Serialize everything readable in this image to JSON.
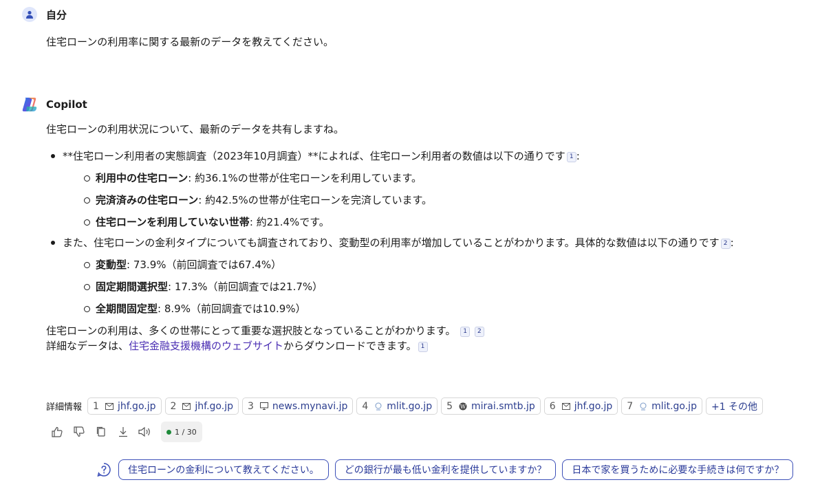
{
  "user": {
    "name": "自分",
    "message": "住宅ローンの利用率に関する最新のデータを教えてください。"
  },
  "copilot": {
    "name": "Copilot",
    "intro": "住宅ローンの利用状況について、最新のデータを共有しますね。",
    "bullet1": {
      "text": "**住宅ローン利用者の実態調査（2023年10月調査）**によれば、住宅ローン利用者の数値は以下の通りです",
      "cite": "1",
      "suffix": ":",
      "items": [
        {
          "label": "利用中の住宅ローン",
          "text": ": 約36.1%の世帯が住宅ローンを利用しています。"
        },
        {
          "label": "完済済みの住宅ローン",
          "text": ": 約42.5%の世帯が住宅ローンを完済しています。"
        },
        {
          "label": "住宅ローンを利用していない世帯",
          "text": ": 約21.4%です。"
        }
      ]
    },
    "bullet2": {
      "text": "また、住宅ローンの金利タイプについても調査されており、変動型の利用率が増加していることがわかります。具体的な数値は以下の通りです",
      "cite": "2",
      "suffix": ":",
      "items": [
        {
          "label": "変動型",
          "text": ": 73.9%（前回調査では67.4%）"
        },
        {
          "label": "固定期間選択型",
          "text": ": 17.3%（前回調査では21.7%）"
        },
        {
          "label": "全期間固定型",
          "text": ": 8.9%（前回調査では10.9%）"
        }
      ]
    },
    "summary": "住宅ローンの利用は、多くの世帯にとって重要な選択肢となっていることがわかります。",
    "summary_cites": [
      "1",
      "2"
    ],
    "download_prefix": "詳細なデータは、",
    "download_link": "住宅金融支援機構のウェブサイト",
    "download_suffix": "からダウンロードできます。",
    "download_cite": "1"
  },
  "references": {
    "label": "詳細情報",
    "items": [
      {
        "num": "1",
        "icon": "mail-icon",
        "domain": "jhf.go.jp"
      },
      {
        "num": "2",
        "icon": "mail-icon",
        "domain": "jhf.go.jp"
      },
      {
        "num": "3",
        "icon": "monitor-icon",
        "domain": "news.mynavi.jp"
      },
      {
        "num": "4",
        "icon": "globe-icon",
        "domain": "mlit.go.jp"
      },
      {
        "num": "5",
        "icon": "wordpress-icon",
        "domain": "mirai.smtb.jp"
      },
      {
        "num": "6",
        "icon": "mail-icon",
        "domain": "jhf.go.jp"
      },
      {
        "num": "7",
        "icon": "globe-icon",
        "domain": "mlit.go.jp"
      }
    ],
    "more": "+1 その他"
  },
  "actions": {
    "counter": "1 / 30",
    "counter_color": "#1e8a3a"
  },
  "suggestions": [
    "住宅ローンの金利について教えてください。",
    "どの銀行が最も低い金利を提供していますか？",
    "日本で家を買うために必要な手続きは何ですか？"
  ],
  "colors": {
    "accent": "#3b4fb8",
    "link": "#4b2fb3"
  }
}
